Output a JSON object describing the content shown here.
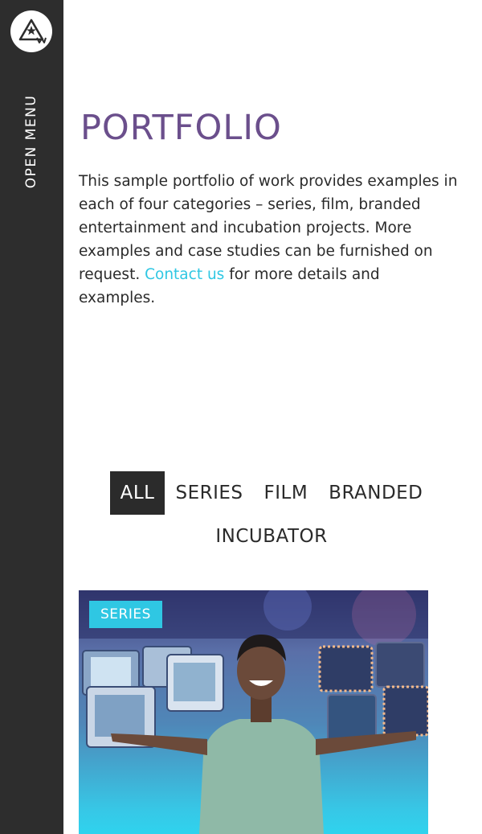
{
  "sidebar": {
    "menu_label": "OPEN MENU",
    "logo_icon": "triangle-star-logo-icon"
  },
  "main": {
    "title": "PORTFOLIO",
    "intro_before": "This sample portfolio of work provides examples in each of four categories – series, film, branded entertainment and incubation projects. More examples and case studies can be furnished on request. ",
    "contact_link": "Contact us",
    "intro_after": " for more details and examples."
  },
  "filters": {
    "items": [
      "ALL",
      "SERIES",
      "FILM",
      "BRANDED",
      "INCUBATOR"
    ],
    "active": "ALL"
  },
  "card": {
    "badge": "SERIES"
  },
  "colors": {
    "accent": "#2fc7e3",
    "title": "#6b4f8c",
    "sidebar": "#2d2d2d"
  }
}
